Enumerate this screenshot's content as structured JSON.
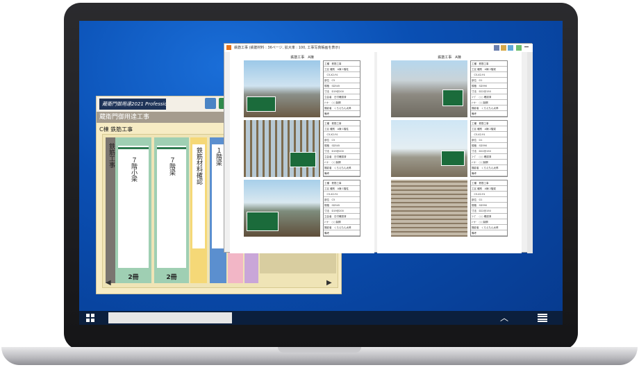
{
  "left_app": {
    "logo": "蔵衛門御用達2021 Professional",
    "title": "蔵衛門御用達工事",
    "breadcrumb": "C棟 鉄筋工事",
    "binders": [
      {
        "label": "鉄筋工事",
        "count": ""
      },
      {
        "label": "７階小梁",
        "count": "2冊"
      },
      {
        "label": "７階梁",
        "count": "2冊"
      },
      {
        "label": "鉄筋材料確認",
        "count": ""
      },
      {
        "label": "１階梁",
        "count": ""
      }
    ]
  },
  "viewer": {
    "title": "鉄筋工事 (鉄筋材料 : 36ページ, 拡大率 : 100, 工事写真帳画を表示)",
    "left_page_heading": "鉄筋工事　A棟",
    "right_page_heading": "鉄筋工事　A棟",
    "left_rows": [
      [
        "工種",
        "鉄筋工事"
      ],
      [
        "工区 種別",
        "A棟 1階柱"
      ],
      [
        "",
        "C5-X2-Y4"
      ],
      [
        "部位",
        "C5"
      ],
      [
        "規格",
        "SD345"
      ],
      [
        "寸法",
        "D19@200"
      ],
      [
        "立会者",
        "日付確認済"
      ],
      [
        "ﾒｰｶｰ",
        "○○製鋼"
      ],
      [
        "撮影者",
        "くらえもん太郎"
      ],
      [
        "備考",
        ""
      ]
    ],
    "right_rows": [
      [
        "工種",
        "鉄筋工事"
      ],
      [
        "工区 種別",
        "A棟 2階梁"
      ],
      [
        "",
        "C5-X2-Y4"
      ],
      [
        "部位",
        "G1"
      ],
      [
        "規格",
        "SD390"
      ],
      [
        "寸法",
        "D22@150"
      ],
      [
        "ｺｰﾌﾟ",
        "○○ 確認済"
      ],
      [
        "ﾒｰｶｰ",
        "○○製鋼"
      ],
      [
        "撮影者",
        "くらえもん太郎"
      ],
      [
        "備考",
        ""
      ]
    ]
  }
}
